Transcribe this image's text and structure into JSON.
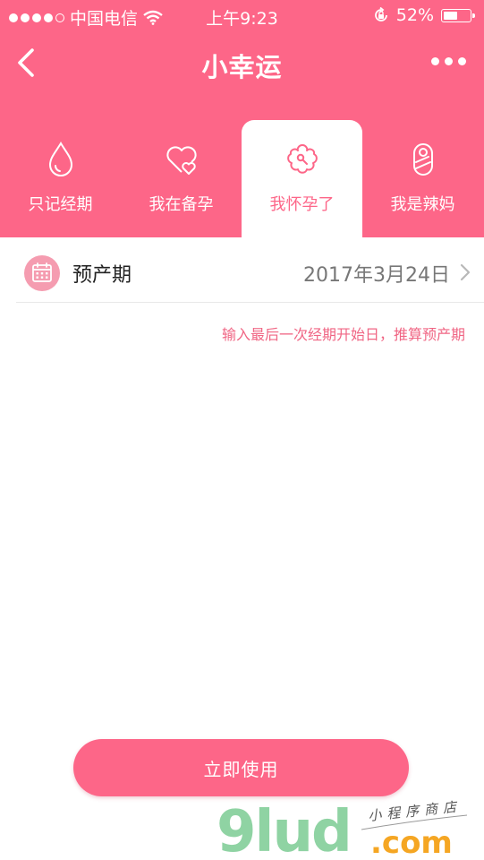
{
  "status_bar": {
    "carrier": "中国电信",
    "time": "上午9:23",
    "battery": "52%"
  },
  "nav": {
    "title": "小幸运"
  },
  "tabs": [
    {
      "label": "只记经期",
      "icon": "drop-icon"
    },
    {
      "label": "我在备孕",
      "icon": "hearts-icon"
    },
    {
      "label": "我怀孕了",
      "icon": "flower-icon",
      "active": true
    },
    {
      "label": "我是辣妈",
      "icon": "baby-icon"
    }
  ],
  "due_date": {
    "label": "预产期",
    "value": "2017年3月24日"
  },
  "hint": "输入最后一次经期开始日，推算预产期",
  "action_button": "立即使用",
  "watermark": {
    "brand": "9lud",
    "suffix": ".com",
    "tagline": "小程序商店"
  },
  "colors": {
    "accent": "#fd6688"
  }
}
